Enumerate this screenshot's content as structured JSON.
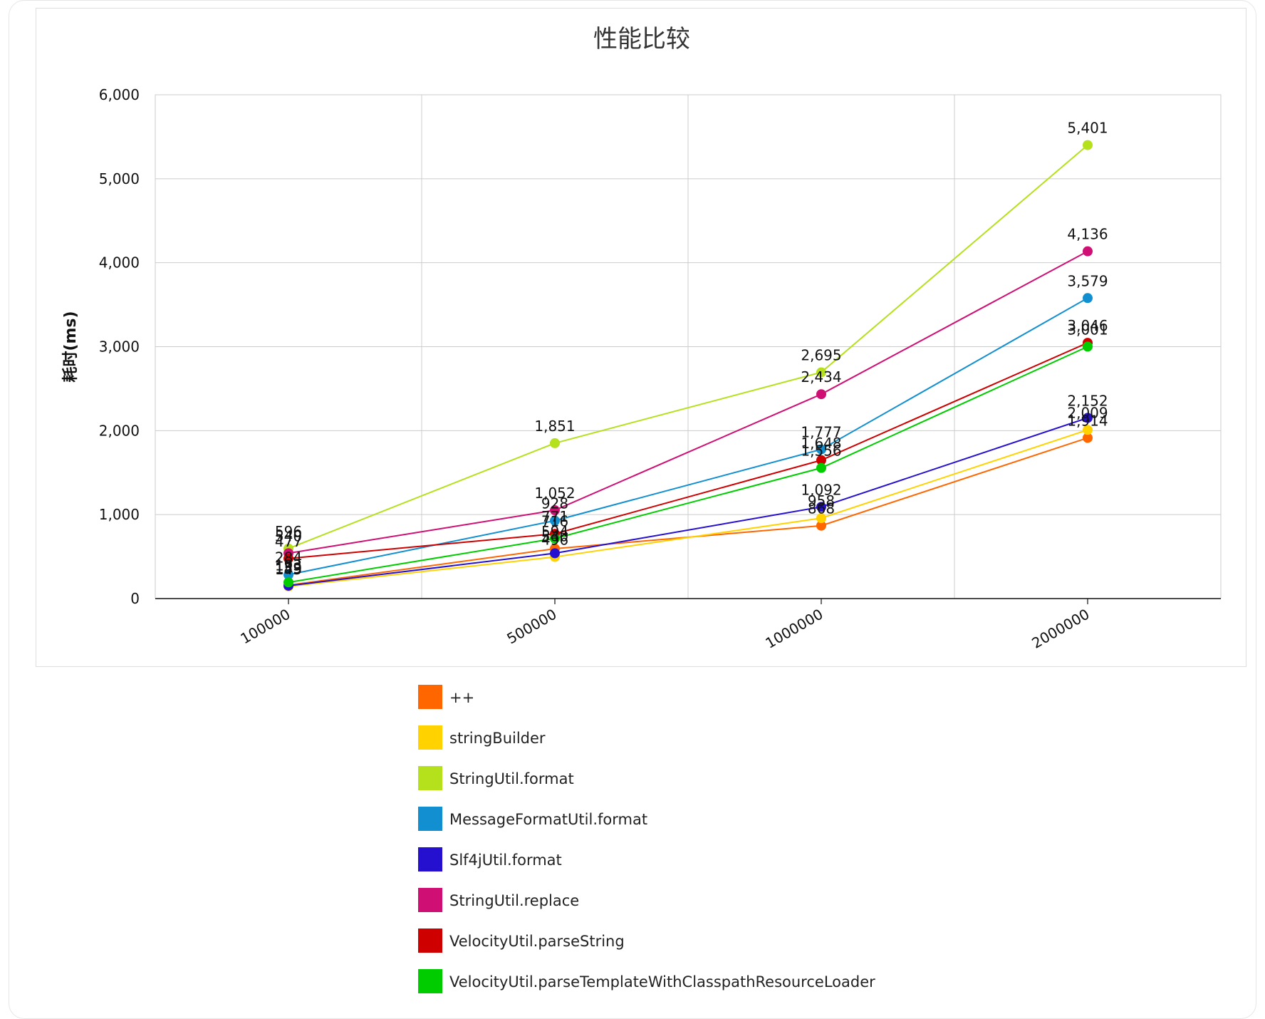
{
  "chart_data": {
    "type": "line",
    "title": "性能比较",
    "xlabel": "",
    "ylabel": "耗时(ms)",
    "categories": [
      "100000",
      "500000",
      "1000000",
      "2000000"
    ],
    "ylim": [
      0,
      6000
    ],
    "yticks": [
      "0",
      "1,000",
      "2,000",
      "3,000",
      "4,000",
      "5,000",
      "6,000"
    ],
    "grid": true,
    "legend_position": "bottom",
    "series": [
      {
        "name": "++",
        "color": "#ff6600",
        "values": [
          159,
          594,
          868,
          1914
        ],
        "labels": [
          "159",
          "594",
          "868",
          "1,914"
        ]
      },
      {
        "name": "stringBuilder",
        "color": "#ffd200",
        "values": [
          145,
          496,
          958,
          2009
        ],
        "labels": [
          "145",
          "496",
          "958",
          "2,009"
        ]
      },
      {
        "name": "StringUtil.format",
        "color": "#b5e01c",
        "values": [
          596,
          1851,
          2695,
          5401
        ],
        "labels": [
          "596",
          "1,851",
          "2,695",
          "5,401"
        ]
      },
      {
        "name": "MessageFormatUtil.format",
        "color": "#118fd0",
        "values": [
          284,
          928,
          1777,
          3579
        ],
        "labels": [
          "284",
          "928",
          "1,777",
          "3,579"
        ]
      },
      {
        "name": "Slf4jUtil.format",
        "color": "#2510cf",
        "values": [
          153,
          540,
          1092,
          2152
        ],
        "labels": [
          "153",
          "540",
          "1,092",
          "2,152"
        ]
      },
      {
        "name": "StringUtil.replace",
        "color": "#cf0f74",
        "values": [
          540,
          1052,
          2434,
          4136
        ],
        "labels": [
          "540",
          "1,052",
          "2,434",
          "4,136"
        ]
      },
      {
        "name": "VelocityUtil.parseString",
        "color": "#cf0000",
        "values": [
          477,
          771,
          1648,
          3046
        ],
        "labels": [
          "477",
          "771",
          "1,648",
          "3,046"
        ]
      },
      {
        "name": "VelocityUtil.parseTemplateWithClasspathResourceLoader",
        "color": "#00cc00",
        "values": [
          193,
          716,
          1556,
          3001
        ],
        "labels": [
          "193",
          "716",
          "1,556",
          "3,001"
        ]
      }
    ]
  }
}
